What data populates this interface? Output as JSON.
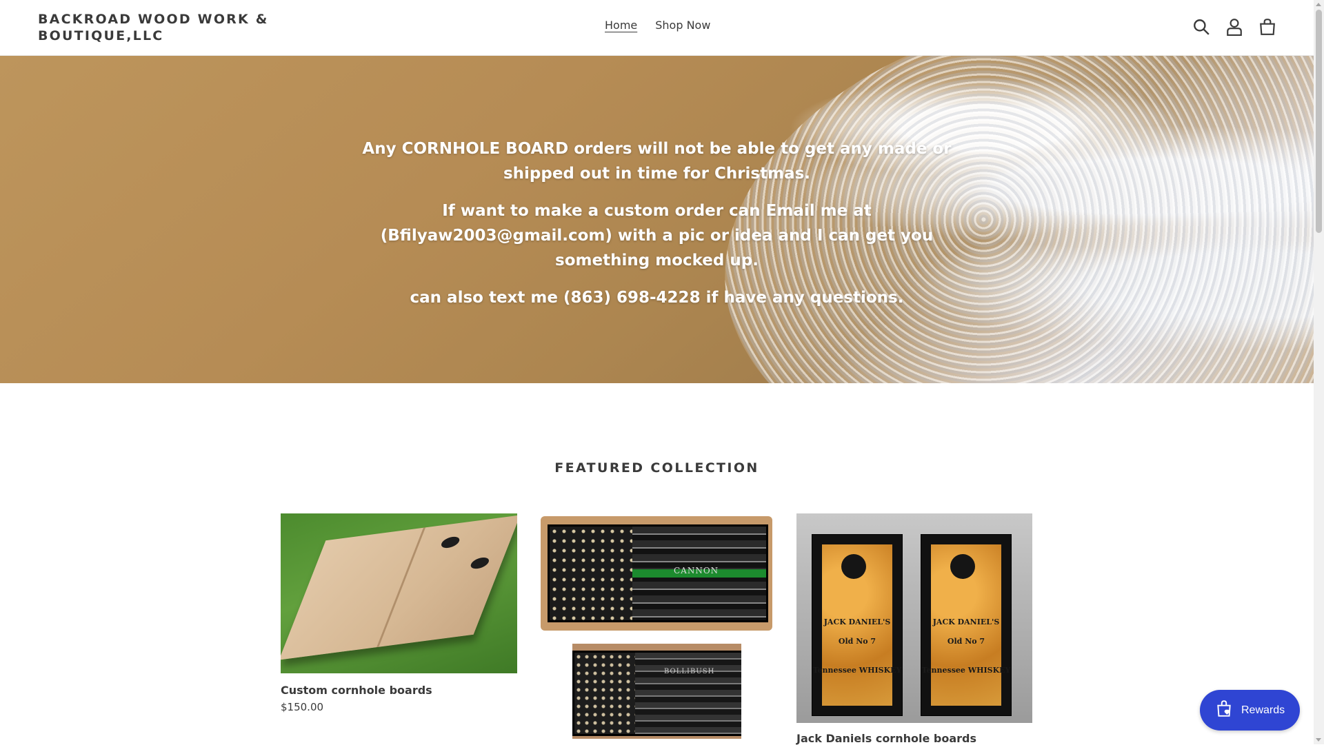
{
  "header": {
    "logo": "BACKROAD WOOD WORK & BOUTIQUE,LLC",
    "nav": [
      {
        "label": "Home",
        "active": true
      },
      {
        "label": "Shop Now",
        "active": false
      }
    ],
    "icons": [
      "search-icon",
      "account-icon",
      "cart-icon"
    ]
  },
  "hero": {
    "paragraphs": [
      "Any CORNHOLE BOARD orders will not be able to get any made or shipped out in time for Christmas.",
      "If want to make a custom order can Email me at (Bfilyaw2003@gmail.com) with a pic or idea and I can get you something mocked up.",
      "can also text me (863) 698-4228 if have any questions."
    ]
  },
  "featured": {
    "title": "FEATURED COLLECTION",
    "products": [
      {
        "title": "Custom cornhole boards",
        "price": "$150.00"
      },
      {
        "title": "",
        "price": "",
        "image_texts": [
          "CANNON",
          "BOLLIBUSH"
        ]
      },
      {
        "title": "Jack Daniels cornhole boards",
        "price": "",
        "image_texts": [
          "JACK DANIEL'S",
          "Old No 7",
          "Tennessee WHISKEY"
        ]
      }
    ]
  },
  "rewards": {
    "label": "Rewards"
  },
  "colors": {
    "rewards_bg": "#2f45d3",
    "text": "#3a3a3a"
  }
}
